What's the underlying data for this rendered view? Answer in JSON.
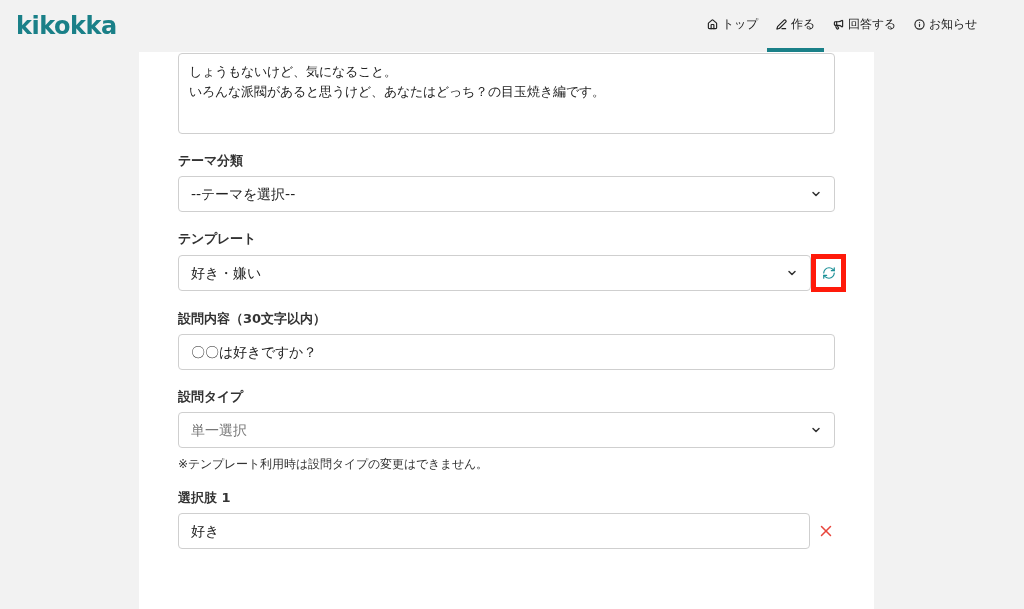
{
  "header": {
    "logo": "kikokka",
    "nav": [
      {
        "label": "トップ",
        "selected": false
      },
      {
        "label": "作る",
        "selected": true
      },
      {
        "label": "回答する",
        "selected": false
      },
      {
        "label": "お知らせ",
        "selected": false
      }
    ]
  },
  "form": {
    "description": [
      "しょうもないけど、気になること。",
      "いろんな派閥があると思うけど、あなたはどっち？の目玉焼き編です。"
    ],
    "fields": [
      {
        "kind": "select",
        "label": "テーマ分類",
        "value": "--テーマを選択--",
        "disabled": false,
        "refresh": false
      },
      {
        "kind": "select",
        "label": "テンプレート",
        "value": "好き・嫌い",
        "disabled": false,
        "refresh": true
      },
      {
        "kind": "input",
        "label": "設問内容（30文字以内）",
        "value": "〇〇は好きですか？",
        "removable": false
      },
      {
        "kind": "select",
        "label": "設問タイプ",
        "value": "単一選択",
        "disabled": true,
        "refresh": false,
        "note": "※テンプレート利用時は設問タイプの変更はできません。"
      },
      {
        "kind": "input",
        "label": "選択肢 1",
        "value": "好き",
        "removable": true
      }
    ]
  }
}
